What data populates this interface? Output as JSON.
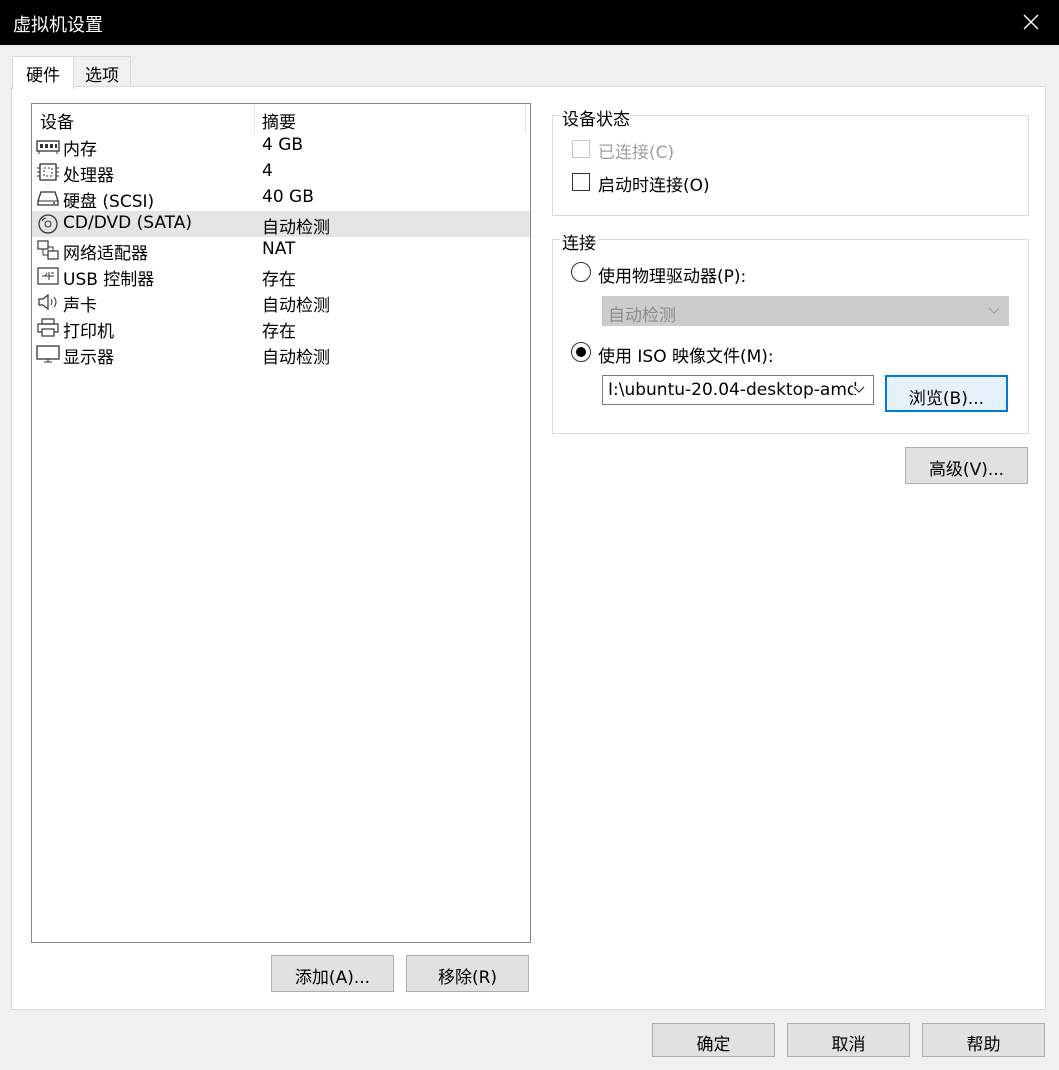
{
  "window": {
    "title": "虚拟机设置"
  },
  "tabs": [
    {
      "label": "硬件",
      "active": true
    },
    {
      "label": "选项",
      "active": false
    }
  ],
  "device_list": {
    "columns": [
      "设备",
      "摘要"
    ],
    "rows": [
      {
        "icon": "memory-icon",
        "name": "内存",
        "summary": "4 GB"
      },
      {
        "icon": "processor-icon",
        "name": "处理器",
        "summary": "4"
      },
      {
        "icon": "hard-disk-icon",
        "name": "硬盘 (SCSI)",
        "summary": "40 GB"
      },
      {
        "icon": "cd-dvd-icon",
        "name": "CD/DVD (SATA)",
        "summary": "自动检测",
        "selected": true
      },
      {
        "icon": "network-adapter-icon",
        "name": "网络适配器",
        "summary": "NAT"
      },
      {
        "icon": "usb-icon",
        "name": "USB 控制器",
        "summary": "存在"
      },
      {
        "icon": "sound-card-icon",
        "name": "声卡",
        "summary": "自动检测"
      },
      {
        "icon": "printer-icon",
        "name": "打印机",
        "summary": "存在"
      },
      {
        "icon": "display-icon",
        "name": "显示器",
        "summary": "自动检测"
      }
    ],
    "add_label": "添加(A)...",
    "remove_label": "移除(R)"
  },
  "device_status": {
    "title": "设备状态",
    "connected_label": "已连接(C)",
    "connected_checked": false,
    "connected_disabled": true,
    "connect_at_power_on_label": "启动时连接(O)",
    "connect_at_power_on_checked": false
  },
  "connection": {
    "title": "连接",
    "physical_drive_label": "使用物理驱动器(P):",
    "physical_drive_selected": false,
    "physical_drive_value": "自动检测",
    "iso_label": "使用 ISO 映像文件(M):",
    "iso_selected": true,
    "iso_value": "I:\\ubuntu-20.04-desktop-amd",
    "browse_label": "浏览(B)..."
  },
  "advanced_label": "高级(V)...",
  "footer": {
    "ok": "确定",
    "cancel": "取消",
    "help": "帮助"
  }
}
